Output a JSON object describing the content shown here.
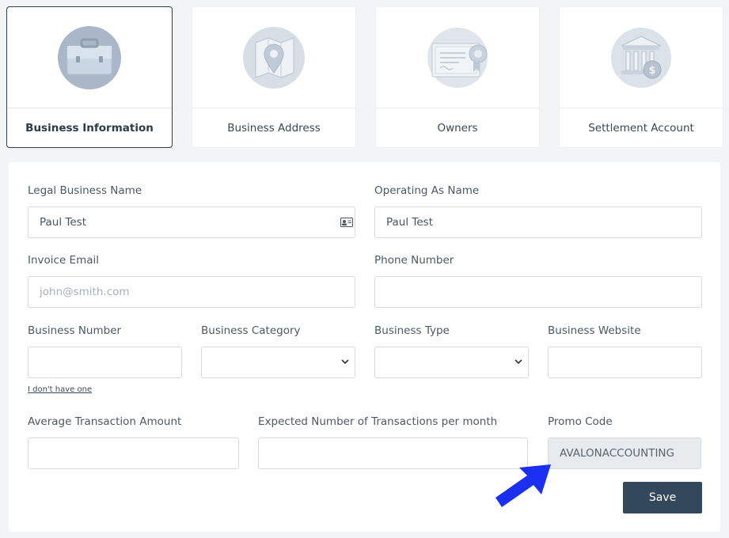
{
  "tabs": [
    {
      "label": "Business Information",
      "icon": "briefcase-icon",
      "active": true
    },
    {
      "label": "Business Address",
      "icon": "map-pin-icon",
      "active": false
    },
    {
      "label": "Owners",
      "icon": "certificate-icon",
      "active": false
    },
    {
      "label": "Settlement Account",
      "icon": "bank-icon",
      "active": false
    }
  ],
  "form": {
    "legal_name": {
      "label": "Legal Business Name",
      "value": "Paul Test"
    },
    "operating_name": {
      "label": "Operating As Name",
      "value": "Paul Test"
    },
    "invoice_email": {
      "label": "Invoice Email",
      "placeholder": "john@smith.com"
    },
    "phone": {
      "label": "Phone Number",
      "value": ""
    },
    "business_number": {
      "label": "Business Number",
      "value": "",
      "link": "I don't have one"
    },
    "category": {
      "label": "Business Category",
      "value": ""
    },
    "type": {
      "label": "Business Type",
      "value": ""
    },
    "website": {
      "label": "Business Website",
      "value": ""
    },
    "avg_amount": {
      "label": "Average Transaction Amount",
      "value": ""
    },
    "expected_tx": {
      "label": "Expected Number of Transactions per month",
      "value": ""
    },
    "promo": {
      "label": "Promo Code",
      "value": "AVALONACCOUNTING"
    },
    "save_label": "Save"
  },
  "colors": {
    "accent": "#34485c",
    "arrow": "#1a2ff0",
    "icon_fill": "#d4dce6"
  }
}
